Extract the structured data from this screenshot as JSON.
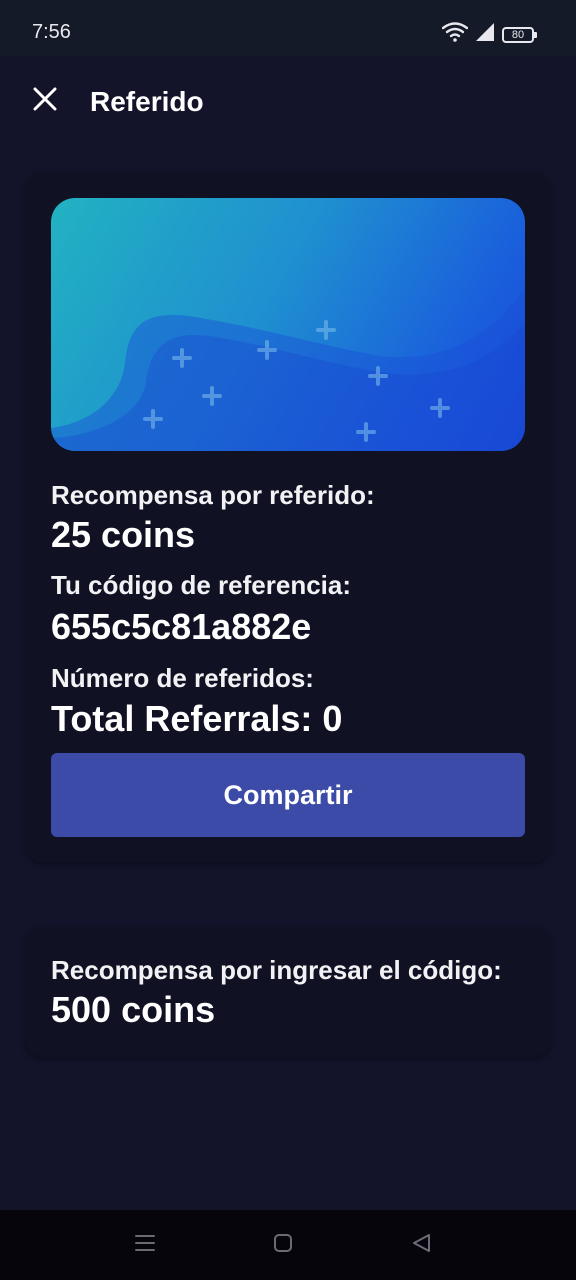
{
  "status_bar": {
    "time": "7:56",
    "battery": "80",
    "icons": [
      "wifi-icon",
      "signal-icon",
      "battery-icon"
    ]
  },
  "app_bar": {
    "title": "Referido",
    "close_icon": "close-icon"
  },
  "referral_card": {
    "banner_icon": "plus-pattern-banner",
    "reward_label": "Recompensa por referido:",
    "reward_value": "25 coins",
    "code_label": "Tu código de referencia:",
    "code_value": "655c5c81a882e",
    "count_label": "Número de referidos:",
    "count_value": "Total Referrals: 0",
    "share_button": "Compartir"
  },
  "enter_code_card": {
    "reward_label": "Recompensa por ingresar el código:",
    "reward_value": "500 coins"
  },
  "nav_bar": {
    "icons": [
      "menu-icon",
      "home-icon",
      "back-icon"
    ]
  },
  "colors": {
    "background": "#13132a",
    "card": "#111124",
    "button": "#3c4aa8",
    "banner_start": "#22b2c2",
    "banner_end": "#1747d8"
  }
}
